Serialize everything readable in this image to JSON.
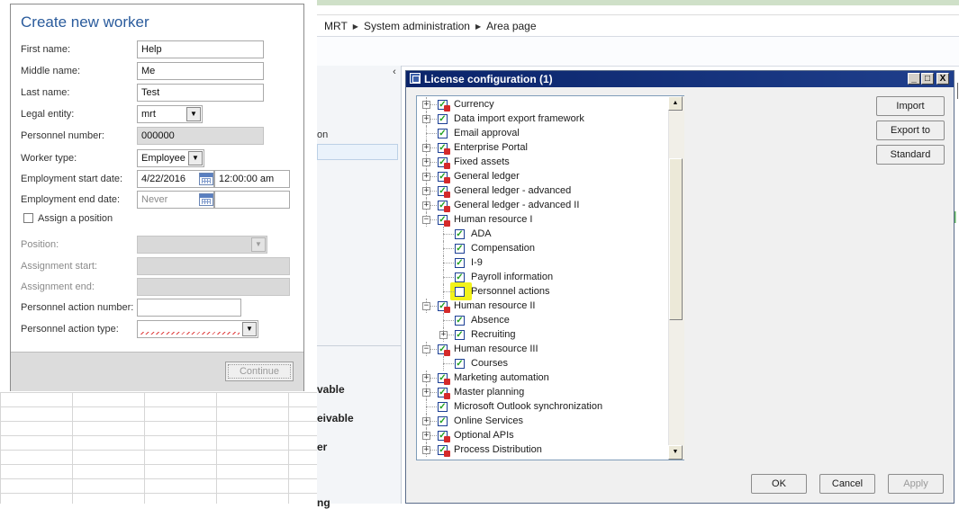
{
  "breadcrumb": [
    "MRT",
    "System administration",
    "Area page"
  ],
  "background": {
    "nav_text": "on",
    "nav_bold": [
      "vable",
      "eivable",
      "er",
      "ng"
    ],
    "collapse_glyph": "‹"
  },
  "worker_dialog": {
    "title": "Create new worker",
    "fields": {
      "first_name": {
        "label": "First name:",
        "value": "Help"
      },
      "middle_name": {
        "label": "Middle name:",
        "value": "Me"
      },
      "last_name": {
        "label": "Last name:",
        "value": "Test"
      },
      "legal_entity": {
        "label": "Legal entity:",
        "value": "mrt"
      },
      "personnel_number": {
        "label": "Personnel number:",
        "value": "000000"
      },
      "worker_type": {
        "label": "Worker type:",
        "value": "Employee"
      },
      "employment_start": {
        "label": "Employment start date:",
        "date": "4/22/2016",
        "time": "12:00:00 am"
      },
      "employment_end": {
        "label": "Employment end date:",
        "placeholder": "Never"
      },
      "assign_position": {
        "label": "Assign a position",
        "checked": false
      },
      "position": {
        "label": "Position:"
      },
      "assignment_start": {
        "label": "Assignment start:"
      },
      "assignment_end": {
        "label": "Assignment end:"
      },
      "personnel_action_number": {
        "label": "Personnel action number:"
      },
      "personnel_action_type": {
        "label": "Personnel action type:"
      }
    },
    "continue_label": "Continue"
  },
  "license_window": {
    "title": "License configuration (1)",
    "window_buttons": [
      "_",
      "□",
      "X"
    ],
    "buttons": {
      "import": "Import",
      "export": "Export to",
      "standard": "Standard"
    },
    "footer": {
      "ok": "OK",
      "cancel": "Cancel",
      "apply": "Apply"
    },
    "tree": [
      {
        "label": "Currency",
        "level": 0,
        "expander": "+",
        "checked": true,
        "locked": true
      },
      {
        "label": "Data import export framework",
        "level": 0,
        "expander": "+",
        "checked": true,
        "locked": false
      },
      {
        "label": "Email approval",
        "level": 0,
        "expander": "",
        "checked": true,
        "locked": false
      },
      {
        "label": "Enterprise Portal",
        "level": 0,
        "expander": "+",
        "checked": true,
        "locked": true
      },
      {
        "label": "Fixed assets",
        "level": 0,
        "expander": "+",
        "checked": true,
        "locked": true
      },
      {
        "label": "General ledger",
        "level": 0,
        "expander": "+",
        "checked": true,
        "locked": true
      },
      {
        "label": "General ledger - advanced",
        "level": 0,
        "expander": "+",
        "checked": true,
        "locked": true
      },
      {
        "label": "General ledger - advanced II",
        "level": 0,
        "expander": "+",
        "checked": true,
        "locked": true
      },
      {
        "label": "Human resource I",
        "level": 0,
        "expander": "−",
        "checked": true,
        "locked": true
      },
      {
        "label": "ADA",
        "level": 1,
        "expander": "",
        "checked": true,
        "locked": false
      },
      {
        "label": "Compensation",
        "level": 1,
        "expander": "",
        "checked": true,
        "locked": false
      },
      {
        "label": "I-9",
        "level": 1,
        "expander": "",
        "checked": true,
        "locked": false
      },
      {
        "label": "Payroll information",
        "level": 1,
        "expander": "",
        "checked": true,
        "locked": false
      },
      {
        "label": "Personnel actions",
        "level": 1,
        "expander": "",
        "checked": false,
        "locked": false,
        "highlight": true
      },
      {
        "label": "Human resource II",
        "level": 0,
        "expander": "−",
        "checked": true,
        "locked": true
      },
      {
        "label": "Absence",
        "level": 1,
        "expander": "",
        "checked": true,
        "locked": false
      },
      {
        "label": "Recruiting",
        "level": 1,
        "expander": "+",
        "checked": true,
        "locked": false
      },
      {
        "label": "Human resource III",
        "level": 0,
        "expander": "−",
        "checked": true,
        "locked": true
      },
      {
        "label": "Courses",
        "level": 1,
        "expander": "",
        "checked": true,
        "locked": false
      },
      {
        "label": "Marketing automation",
        "level": 0,
        "expander": "+",
        "checked": true,
        "locked": true
      },
      {
        "label": "Master planning",
        "level": 0,
        "expander": "+",
        "checked": true,
        "locked": true
      },
      {
        "label": "Microsoft Outlook synchronization",
        "level": 0,
        "expander": "",
        "checked": true,
        "locked": false
      },
      {
        "label": "Online Services",
        "level": 0,
        "expander": "+",
        "checked": true,
        "locked": false
      },
      {
        "label": "Optional APIs",
        "level": 0,
        "expander": "+",
        "checked": true,
        "locked": true
      },
      {
        "label": "Process Distribution",
        "level": 0,
        "expander": "+",
        "checked": true,
        "locked": true
      }
    ]
  },
  "colors": {
    "dialog_title": "#2a5b9c",
    "titlebar": "#0a246a",
    "highlight": "#f2f21a",
    "check": "#21a121",
    "lock": "#d42a2a"
  }
}
